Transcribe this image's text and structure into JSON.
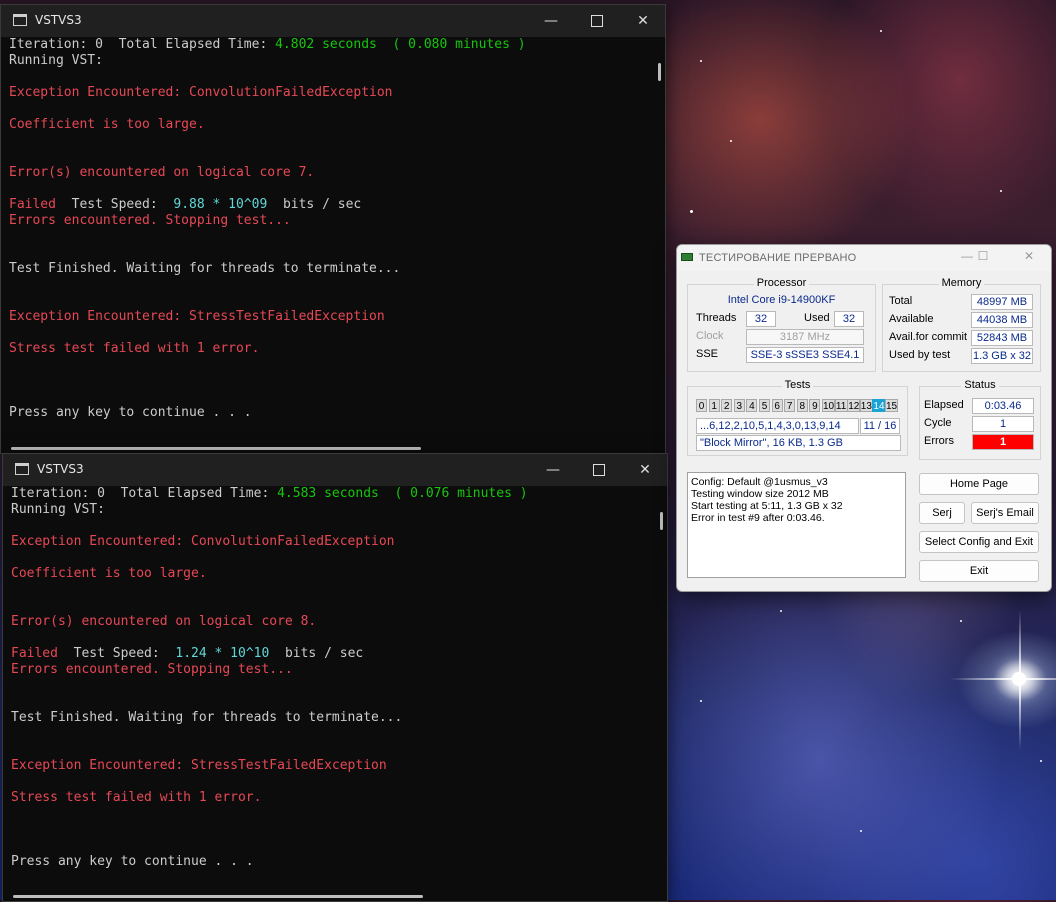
{
  "console1": {
    "title": "VSTVS3",
    "lines": [
      [
        {
          "t": "Iteration: 0  Total Elapsed Time: ",
          "c": ""
        },
        {
          "t": "4.802 seconds  ( 0.080 minutes )",
          "c": "green"
        }
      ],
      [
        {
          "t": "Running VST:",
          "c": ""
        }
      ],
      [],
      [
        {
          "t": "Exception Encountered: ConvolutionFailedException",
          "c": "red"
        }
      ],
      [],
      [
        {
          "t": "Coefficient is too large.",
          "c": "red"
        }
      ],
      [],
      [],
      [
        {
          "t": "Error(s) encountered on logical core 7.",
          "c": "red"
        }
      ],
      [],
      [
        {
          "t": "Failed",
          "c": "red"
        },
        {
          "t": "  Test Speed:  ",
          "c": ""
        },
        {
          "t": "9.88 * 10^09",
          "c": "cyan"
        },
        {
          "t": "  bits / sec",
          "c": ""
        }
      ],
      [
        {
          "t": "Errors encountered. Stopping test...",
          "c": "red"
        }
      ],
      [],
      [],
      [
        {
          "t": "Test Finished. Waiting for threads to terminate...",
          "c": ""
        }
      ],
      [],
      [],
      [
        {
          "t": "Exception Encountered: StressTestFailedException",
          "c": "red"
        }
      ],
      [],
      [
        {
          "t": "Stress test failed with 1 error.",
          "c": "red"
        }
      ],
      [],
      [],
      [],
      [
        {
          "t": "Press any key to continue . . .",
          "c": ""
        }
      ]
    ]
  },
  "console2": {
    "title": "VSTVS3",
    "lines": [
      [
        {
          "t": "Iteration: 0  Total Elapsed Time: ",
          "c": ""
        },
        {
          "t": "4.583 seconds  ( 0.076 minutes )",
          "c": "green"
        }
      ],
      [
        {
          "t": "Running VST:",
          "c": ""
        }
      ],
      [],
      [
        {
          "t": "Exception Encountered: ConvolutionFailedException",
          "c": "red"
        }
      ],
      [],
      [
        {
          "t": "Coefficient is too large.",
          "c": "red"
        }
      ],
      [],
      [],
      [
        {
          "t": "Error(s) encountered on logical core 8.",
          "c": "red"
        }
      ],
      [],
      [
        {
          "t": "Failed",
          "c": "red"
        },
        {
          "t": "  Test Speed:  ",
          "c": ""
        },
        {
          "t": "1.24 * 10^10",
          "c": "cyan"
        },
        {
          "t": "  bits / sec",
          "c": ""
        }
      ],
      [
        {
          "t": "Errors encountered. Stopping test...",
          "c": "red"
        }
      ],
      [],
      [],
      [
        {
          "t": "Test Finished. Waiting for threads to terminate...",
          "c": ""
        }
      ],
      [],
      [],
      [
        {
          "t": "Exception Encountered: StressTestFailedException",
          "c": "red"
        }
      ],
      [],
      [
        {
          "t": "Stress test failed with 1 error.",
          "c": "red"
        }
      ],
      [],
      [],
      [],
      [
        {
          "t": "Press any key to continue . . .",
          "c": ""
        }
      ]
    ]
  },
  "testmem": {
    "title": "ТЕСТИРОВАНИЕ ПРЕРВАНО",
    "processor": {
      "label": "Processor",
      "name": "Intel Core i9-14900KF",
      "threads_label": "Threads",
      "threads": "32",
      "used_label": "Used",
      "used": "32",
      "clock_label": "Clock",
      "clock": "3187 MHz",
      "sse_label": "SSE",
      "sse": "SSE-3 sSSE3 SSE4.1"
    },
    "memory": {
      "label": "Memory",
      "total_label": "Total",
      "total": "48997 MB",
      "available_label": "Available",
      "available": "44038 MB",
      "commit_label": "Avail.for commit",
      "commit": "52843 MB",
      "usedby_label": "Used by test",
      "usedby": "1.3 GB x 32"
    },
    "tests": {
      "label": "Tests",
      "cells": [
        "0",
        "1",
        "2",
        "3",
        "4",
        "5",
        "6",
        "7",
        "8",
        "9",
        "10",
        "11",
        "12",
        "13",
        "14",
        "15"
      ],
      "active_index": 14,
      "sequence": "...6,12,2,10,5,1,4,3,0,13,9,14",
      "progress": "11 / 16",
      "current": "\"Block Mirror\", 16 KB, 1.3 GB"
    },
    "status": {
      "label": "Status",
      "elapsed_label": "Elapsed",
      "elapsed": "0:03.46",
      "cycle_label": "Cycle",
      "cycle": "1",
      "errors_label": "Errors",
      "errors": "1"
    },
    "log": [
      "Config: Default @1usmus_v3",
      "Testing window size 2012 MB",
      "Start testing at 5:11, 1.3 GB x 32",
      "Error in test #9 after 0:03.46."
    ],
    "buttons": {
      "home": "Home Page",
      "serj": "Serj",
      "serj_email": "Serj's Email",
      "select_config": "Select Config and Exit",
      "exit": "Exit"
    }
  }
}
